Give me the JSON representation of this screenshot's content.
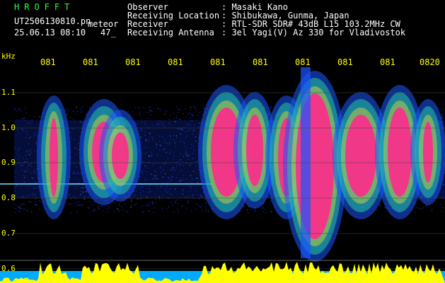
{
  "header": {
    "app_title": "HROFFT",
    "filename": "UT2506130810.pn",
    "mode": "meteor",
    "date_time": "25.06.13 08:10",
    "count": "47_",
    "fields": [
      {
        "label": "Observer",
        "value": ": Masaki Kano"
      },
      {
        "label": "Receiving Location",
        "value": ": Shibukawa, Gunma, Japan"
      },
      {
        "label": "Receiver",
        "value": ": RTL-SDR SDR# 43dB L15 103.2MHz CW"
      },
      {
        "label": "Receiving Antenna",
        "value": ": 3el Yagi(V) Az 330 for Vladivostok"
      }
    ]
  },
  "spectrogram": {
    "y_unit": "kHz",
    "y_ticks": [
      "1.1",
      "1.0",
      "0.9",
      "0.8",
      "0.7",
      "0.6"
    ],
    "time_ticks": [
      "081",
      "081",
      "081",
      "081",
      "081",
      "081",
      "081",
      "081",
      "081",
      "0820"
    ],
    "colors": {
      "background": "#000000",
      "axis": "#ffff00",
      "header_green": "#33ff33"
    }
  }
}
